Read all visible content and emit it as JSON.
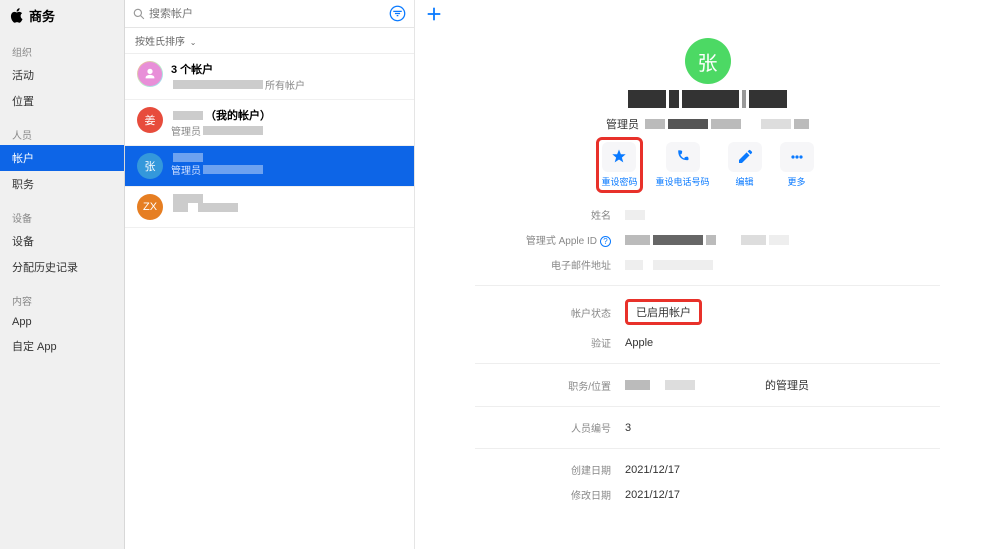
{
  "app_title": "商务",
  "sidebar": {
    "sections": [
      {
        "title": "组织",
        "items": [
          "活动",
          "位置"
        ]
      },
      {
        "title": "人员",
        "items": [
          "帐户",
          "职务"
        ],
        "active_index": 0
      },
      {
        "title": "设备",
        "items": [
          "设备",
          "分配历史记录"
        ]
      },
      {
        "title": "内容",
        "items": [
          "App",
          "自定 App"
        ]
      }
    ]
  },
  "search": {
    "placeholder": "搜索帐户"
  },
  "sort_label": "按姓氏排序",
  "accounts": [
    {
      "avatar_text": "",
      "avatar_style": "ring",
      "title": "3 个帐户",
      "sub_suffix": "所有帐户"
    },
    {
      "avatar_text": "姜",
      "avatar_style": "red",
      "title_suffix": "（我的帐户）",
      "sub_prefix": "管理员"
    },
    {
      "avatar_text": "张",
      "avatar_style": "blue",
      "selected": true,
      "sub_prefix": "管理员"
    },
    {
      "avatar_text": "ZX",
      "avatar_style": "orange"
    }
  ],
  "detail": {
    "avatar_text": "张",
    "role_label": "管理员",
    "actions": [
      {
        "key": "reset-password",
        "label": "重设密码",
        "highlighted": true
      },
      {
        "key": "reset-phone",
        "label": "重设电话号码"
      },
      {
        "key": "edit",
        "label": "编辑"
      },
      {
        "key": "more",
        "label": "更多"
      }
    ],
    "fields": {
      "name_label": "姓名",
      "apple_id_label": "管理式 Apple ID",
      "email_label": "电子邮件地址",
      "status_label": "帐户状态",
      "status_value": "已启用帐户",
      "verify_label": "验证",
      "verify_value": "Apple",
      "role_label": "职务/位置",
      "role_value": "的管理员",
      "person_id_label": "人员编号",
      "person_id_value": "3",
      "created_label": "创建日期",
      "created_value": "2021/12/17",
      "modified_label": "修改日期",
      "modified_value": "2021/12/17"
    }
  }
}
